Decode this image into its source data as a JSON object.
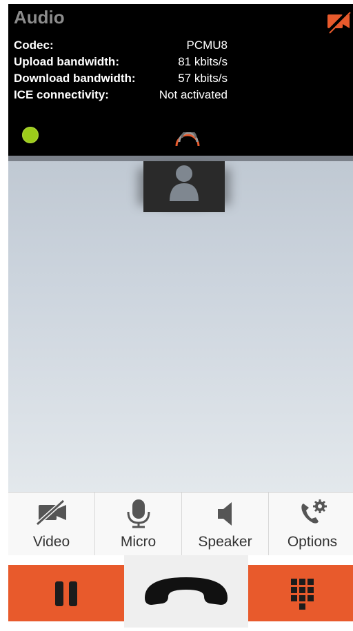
{
  "audio_panel": {
    "title": "Audio",
    "rows": [
      {
        "label": "Codec:",
        "value": "PCMU8"
      },
      {
        "label": "Upload bandwidth:",
        "value": "81 kbits/s"
      },
      {
        "label": "Download bandwidth:",
        "value": "57 kbits/s"
      },
      {
        "label": "ICE connectivity:",
        "value": "Not activated"
      }
    ],
    "status_dot_color": "#9ccc1a",
    "icons": [
      "video-off-icon",
      "call-quality-icon"
    ]
  },
  "controls": [
    {
      "label": "Video",
      "icon": "video-off-icon"
    },
    {
      "label": "Micro",
      "icon": "microphone-icon"
    },
    {
      "label": "Speaker",
      "icon": "speaker-icon"
    },
    {
      "label": "Options",
      "icon": "call-settings-icon"
    }
  ],
  "bottom_bar": {
    "accent": "#e85a2c",
    "icons": [
      "pause-icon",
      "hangup-icon",
      "dialpad-icon"
    ]
  }
}
